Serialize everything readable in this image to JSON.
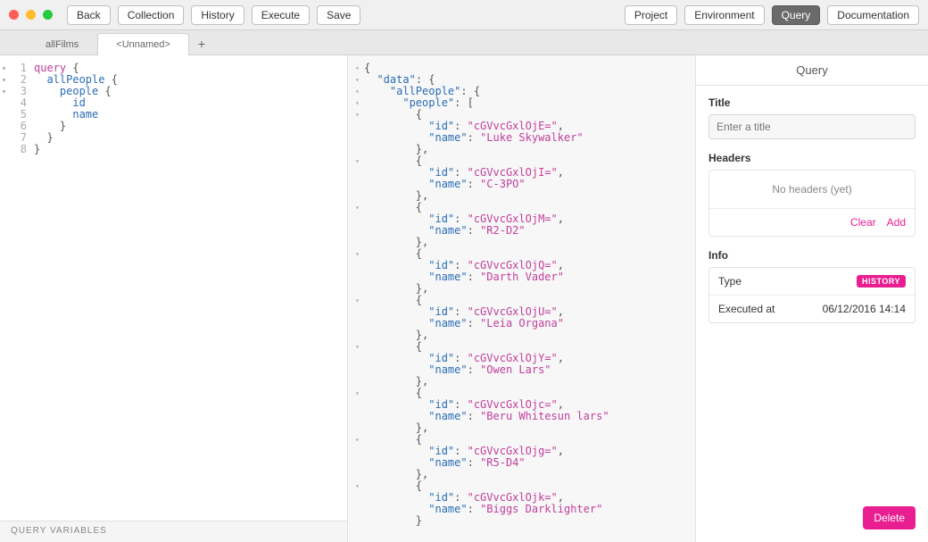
{
  "toolbar": {
    "back": "Back",
    "collection": "Collection",
    "history": "History",
    "execute": "Execute",
    "save": "Save",
    "project": "Project",
    "environment": "Environment",
    "query": "Query",
    "documentation": "Documentation"
  },
  "tabs": {
    "items": [
      {
        "label": "allFilms",
        "active": false
      },
      {
        "label": "<Unnamed>",
        "active": true
      }
    ],
    "add": "+"
  },
  "editor": {
    "lines": [
      {
        "n": 1,
        "fold": true,
        "tokens": [
          [
            "kw",
            "query"
          ],
          [
            "punc",
            " {"
          ]
        ]
      },
      {
        "n": 2,
        "fold": true,
        "tokens": [
          [
            "punc",
            "  "
          ],
          [
            "fld",
            "allPeople"
          ],
          [
            "punc",
            " {"
          ]
        ]
      },
      {
        "n": 3,
        "fold": true,
        "tokens": [
          [
            "punc",
            "    "
          ],
          [
            "fld",
            "people"
          ],
          [
            "punc",
            " {"
          ]
        ]
      },
      {
        "n": 4,
        "fold": false,
        "tokens": [
          [
            "punc",
            "      "
          ],
          [
            "fld",
            "id"
          ]
        ]
      },
      {
        "n": 5,
        "fold": false,
        "tokens": [
          [
            "punc",
            "      "
          ],
          [
            "fld",
            "name"
          ]
        ]
      },
      {
        "n": 6,
        "fold": false,
        "tokens": [
          [
            "punc",
            "    }"
          ]
        ]
      },
      {
        "n": 7,
        "fold": false,
        "tokens": [
          [
            "punc",
            "  }"
          ]
        ]
      },
      {
        "n": 8,
        "fold": false,
        "tokens": [
          [
            "punc",
            "}"
          ]
        ]
      }
    ],
    "variables_label": "QUERY VARIABLES"
  },
  "result": {
    "people": [
      {
        "id": "cGVvcGxlOjE=",
        "name": "Luke Skywalker"
      },
      {
        "id": "cGVvcGxlOjI=",
        "name": "C-3PO"
      },
      {
        "id": "cGVvcGxlOjM=",
        "name": "R2-D2"
      },
      {
        "id": "cGVvcGxlOjQ=",
        "name": "Darth Vader"
      },
      {
        "id": "cGVvcGxlOjU=",
        "name": "Leia Organa"
      },
      {
        "id": "cGVvcGxlOjY=",
        "name": "Owen Lars"
      },
      {
        "id": "cGVvcGxlOjc=",
        "name": "Beru Whitesun lars"
      },
      {
        "id": "cGVvcGxlOjg=",
        "name": "R5-D4"
      },
      {
        "id": "cGVvcGxlOjk=",
        "name": "Biggs Darklighter"
      }
    ]
  },
  "side": {
    "header": "Query",
    "title_label": "Title",
    "title_placeholder": "Enter a title",
    "headers_label": "Headers",
    "headers_empty": "No headers (yet)",
    "clear": "Clear",
    "add": "Add",
    "info_label": "Info",
    "info": {
      "type_label": "Type",
      "type_value": "HISTORY",
      "executed_label": "Executed at",
      "executed_value": "06/12/2016 14:14"
    },
    "delete": "Delete"
  }
}
